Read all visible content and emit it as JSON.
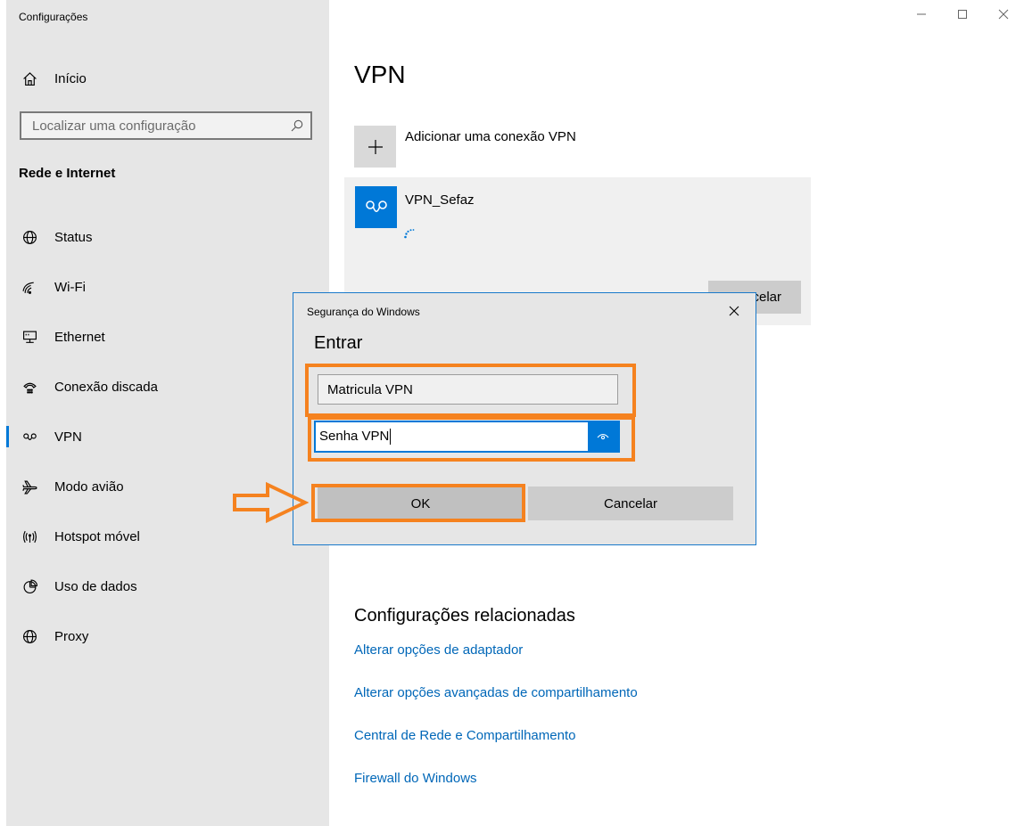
{
  "window": {
    "title": "Configurações"
  },
  "sidebar": {
    "home_label": "Início",
    "search_placeholder": "Localizar uma configuração",
    "section_title": "Rede e Internet",
    "items": [
      {
        "label": "Status",
        "icon": "globe-icon"
      },
      {
        "label": "Wi-Fi",
        "icon": "wifi-icon"
      },
      {
        "label": "Ethernet",
        "icon": "ethernet-icon"
      },
      {
        "label": "Conexão discada",
        "icon": "dialup-icon"
      },
      {
        "label": "VPN",
        "icon": "vpn-icon",
        "active": true
      },
      {
        "label": "Modo avião",
        "icon": "airplane-icon"
      },
      {
        "label": "Hotspot móvel",
        "icon": "hotspot-icon"
      },
      {
        "label": "Uso de dados",
        "icon": "data-usage-icon"
      },
      {
        "label": "Proxy",
        "icon": "globe-icon"
      }
    ]
  },
  "main": {
    "title": "VPN",
    "add_vpn_label": "Adicionar uma conexão VPN",
    "vpn_connection": {
      "name": "VPN_Sefaz",
      "status": "connecting",
      "cancel_label": "Cancelar"
    },
    "related": {
      "title": "Configurações relacionadas",
      "links": [
        "Alterar opções de adaptador",
        "Alterar opções avançadas de compartilhamento",
        "Central de Rede e Compartilhamento",
        "Firewall do Windows"
      ]
    }
  },
  "dialog": {
    "caption": "Segurança do Windows",
    "heading": "Entrar",
    "username_value": "Matricula VPN",
    "password_value": "Senha VPN",
    "ok_label": "OK",
    "cancel_label": "Cancelar"
  },
  "colors": {
    "accent": "#0078d7",
    "link": "#0067b8",
    "highlight": "#f5821f"
  }
}
